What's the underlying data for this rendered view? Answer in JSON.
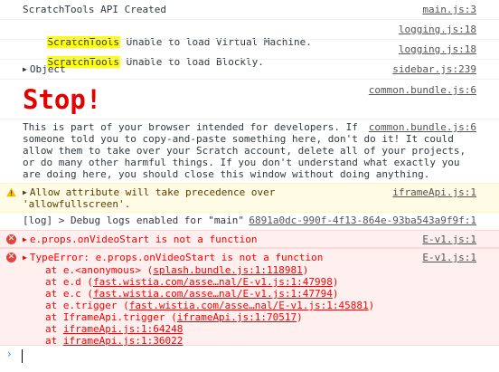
{
  "messages": {
    "api_created": {
      "text": "ScratchTools API Created",
      "source": "main.js:3"
    },
    "vm_fail": {
      "badge": "ScratchTools",
      "text": " Unable to load Virtual Machine.",
      "source": "logging.js:18"
    },
    "blockly_fail": {
      "badge": "ScratchTools",
      "text": " Unable to load Blockly.",
      "source": "logging.js:18"
    },
    "object": {
      "text": "Object",
      "source": "sidebar.js:239"
    },
    "stop": {
      "heading": "Stop!",
      "source": "common.bundle.js:6"
    },
    "selfxss": {
      "lines": [
        "This is part of your browser intended for developers. If",
        "someone told you to copy-and-paste something here, don't do it! It could",
        "allow them to take over your Scratch account, delete all of your projects,",
        "or do many other harmful things. If you don't understand what exactly you",
        "are doing here, you should close this window without doing anything."
      ],
      "source": "common.bundle.js:6"
    },
    "warning": {
      "lines": [
        "Allow attribute will take precedence over",
        "'allowfullscreen'."
      ],
      "source": "iframeApi.js:1"
    },
    "debug": {
      "text": "[log] > Debug logs enabled for \"main\" ",
      "source": "6891a0dc-990f-4f13-864e-93ba543a9f9f:1"
    },
    "error1": {
      "text": "e.props.onVideoStart is not a function",
      "source": "E-v1.js:1"
    },
    "error2": {
      "text": "TypeError: e.props.onVideoStart is not a function",
      "source": "E-v1.js:1",
      "trace": [
        {
          "prefix": "at e.<anonymous> (",
          "link": "splash.bundle.js:1:118981",
          "suffix": ")"
        },
        {
          "prefix": "at e.d (",
          "link": "fast.wistia.com/asse…nal/E-v1.js:1:47998",
          "suffix": ")"
        },
        {
          "prefix": "at e.c (",
          "link": "fast.wistia.com/asse…nal/E-v1.js:1:47794",
          "suffix": ")"
        },
        {
          "prefix": "at e.trigger (",
          "link": "fast.wistia.com/asse…nal/E-v1.js:1:45881",
          "suffix": ")"
        },
        {
          "prefix": "at IframeApi.trigger (",
          "link": "iframeApi.js:1:70517",
          "suffix": ")"
        },
        {
          "prefix": "at ",
          "link": "iframeApi.js:1:64248",
          "suffix": ""
        },
        {
          "prefix": "at ",
          "link": "iframeApi.js:1:36022",
          "suffix": ""
        }
      ]
    }
  },
  "prompt": {
    "symbol": "›"
  },
  "colors": {
    "error": "#ff0000",
    "warning_bg": "#fffbe5",
    "error_bg": "#fff0f0",
    "badge": "#ffff00",
    "prompt": "#2196f3"
  },
  "icons": {
    "warning": "warning-triangle-icon",
    "error": "error-circle-icon",
    "expand": "expand-triangle-icon"
  }
}
